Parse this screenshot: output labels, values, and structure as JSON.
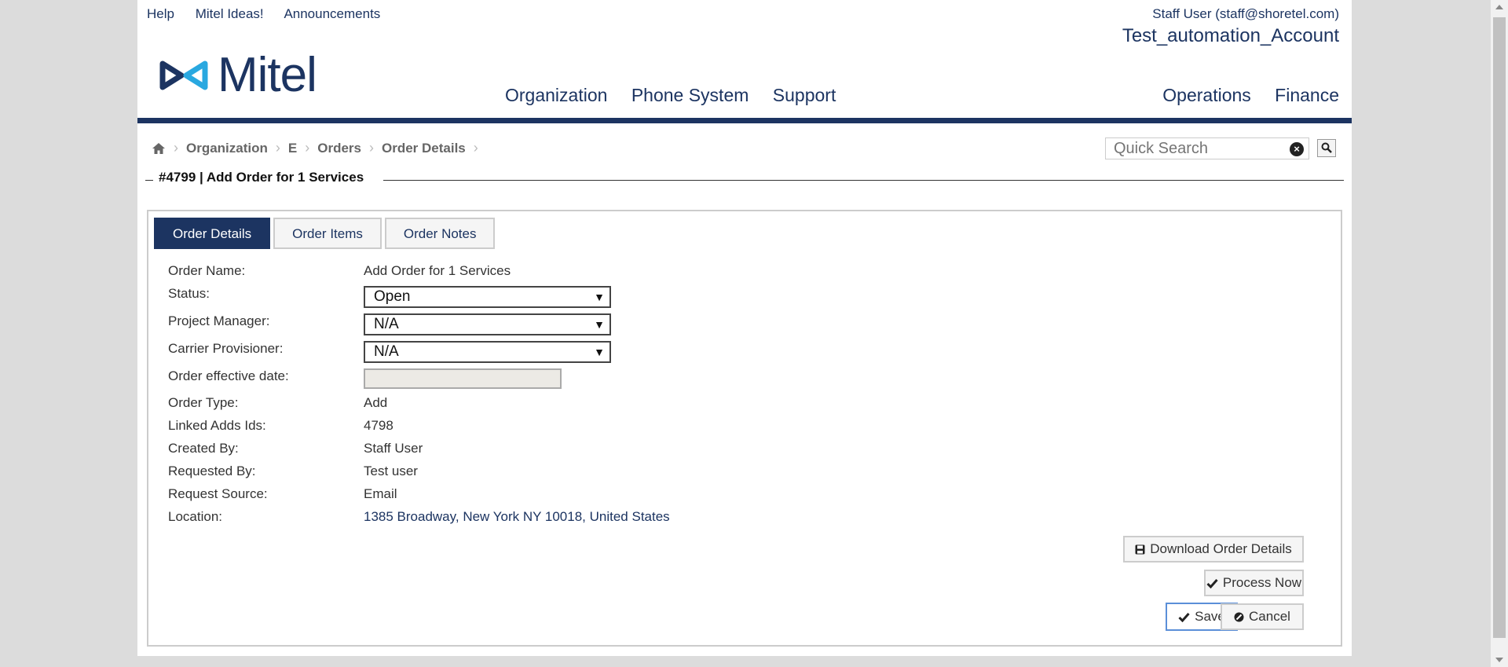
{
  "top_links": [
    "Help",
    "Mitel Ideas!",
    "Announcements"
  ],
  "user_info": "Staff User (staff@shoretel.com)",
  "account_name": "Test_automation_Account",
  "logo_text": "Mitel",
  "main_nav": [
    "Organization",
    "Phone System",
    "Support"
  ],
  "right_nav": [
    "Operations",
    "Finance"
  ],
  "breadcrumb": [
    "Organization",
    "E",
    "Orders",
    "Order Details"
  ],
  "search": {
    "placeholder": "Quick Search",
    "clear_glyph": "×"
  },
  "page_title": "#4799 | Add Order for 1 Services",
  "tabs": [
    {
      "label": "Order Details",
      "active": true
    },
    {
      "label": "Order Items",
      "active": false
    },
    {
      "label": "Order Notes",
      "active": false
    }
  ],
  "fields": {
    "order_name": {
      "label": "Order Name:",
      "value": "Add Order for 1 Services"
    },
    "status": {
      "label": "Status:",
      "value": "Open"
    },
    "project_manager": {
      "label": "Project Manager:",
      "value": "N/A"
    },
    "carrier_provisioner": {
      "label": "Carrier Provisioner:",
      "value": "N/A"
    },
    "effective_date": {
      "label": "Order effective date:",
      "value": ""
    },
    "order_type": {
      "label": "Order Type:",
      "value": "Add"
    },
    "linked_adds": {
      "label": "Linked Adds Ids:",
      "value": "4798"
    },
    "created_by": {
      "label": "Created By:",
      "value": "Staff User"
    },
    "requested_by": {
      "label": "Requested By:",
      "value": "Test user"
    },
    "request_source": {
      "label": "Request Source:",
      "value": "Email"
    },
    "location": {
      "label": "Location:",
      "value": "1385 Broadway, New York NY 10018, United States"
    }
  },
  "buttons": {
    "download": "Download Order Details",
    "process": "Process Now",
    "save": "Save",
    "cancel": "Cancel"
  },
  "colors": {
    "brand_navy": "#1c3461",
    "logo_cyan": "#29a8e0",
    "focus_border": "#5b8fd8"
  }
}
